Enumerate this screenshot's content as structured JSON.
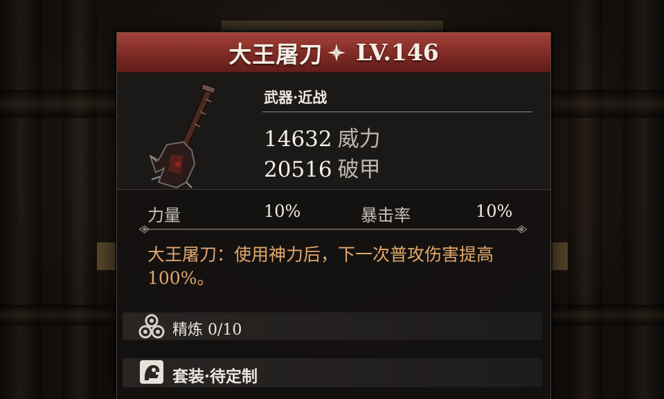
{
  "title": {
    "weapon_name": "大王屠刀",
    "level": "LV.146",
    "star_icon": "four-point-star-icon"
  },
  "weapon": {
    "type": "武器·近战",
    "icon": "cleaver-weapon-icon",
    "stats": [
      {
        "value": "14632",
        "label": "威力"
      },
      {
        "value": "20516",
        "label": "破甲"
      }
    ]
  },
  "attributes": [
    {
      "label": "力量",
      "value": "10%"
    },
    {
      "label": "暴击率",
      "value": "10%"
    }
  ],
  "description": "大王屠刀：使用神力后，下一次普攻伤害提高100%。",
  "refine": {
    "icon": "refine-orbs-icon",
    "label": "精炼 0/10"
  },
  "set": {
    "icon": "set-armor-icon",
    "label": "套装·待定制"
  },
  "colors": {
    "title_bar": "#7e2a25",
    "description_text": "#e2a86b",
    "panel_bg": "#1b1918"
  }
}
